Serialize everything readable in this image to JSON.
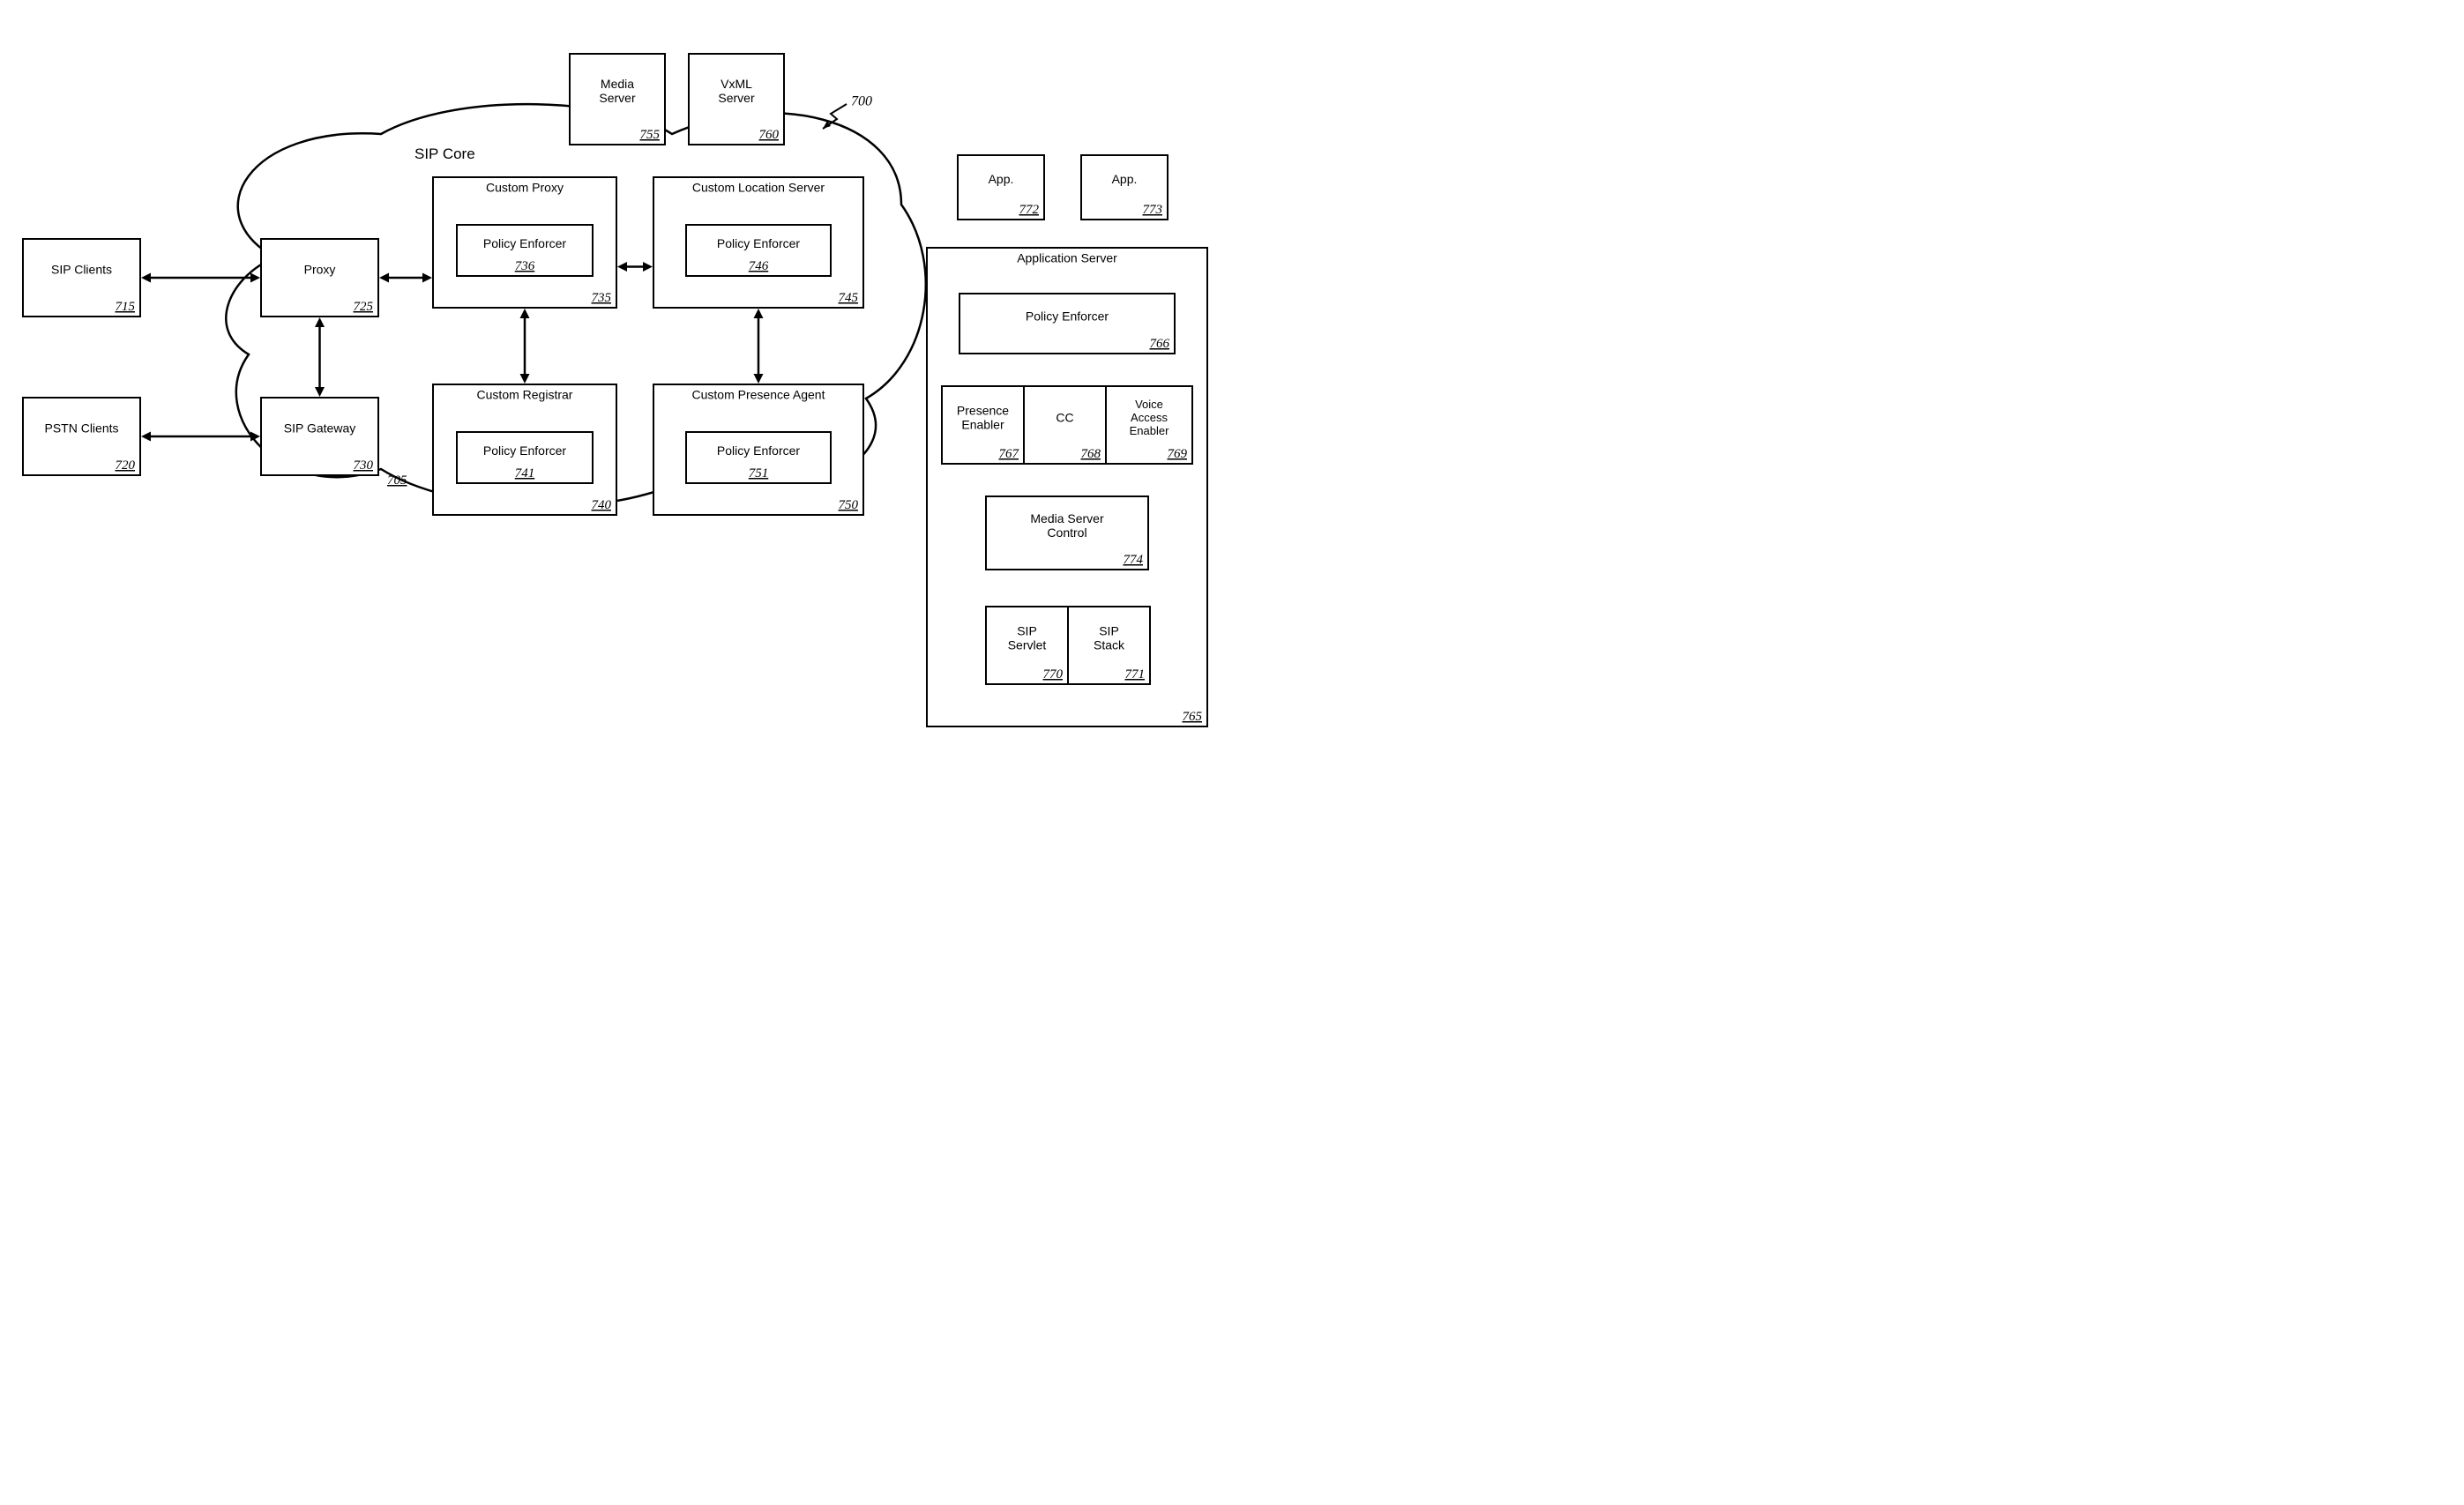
{
  "fig_ref": "700",
  "sip_core_label": "SIP Core",
  "sip_core_ref": "705",
  "sip_clients": {
    "title": "SIP Clients",
    "ref": "715"
  },
  "pstn_clients": {
    "title": "PSTN Clients",
    "ref": "720"
  },
  "proxy": {
    "title": "Proxy",
    "ref": "725"
  },
  "sip_gateway": {
    "title": "SIP Gateway",
    "ref": "730"
  },
  "custom_proxy": {
    "title": "Custom Proxy",
    "ref": "735",
    "pe_title": "Policy Enforcer",
    "pe_ref": "736"
  },
  "custom_registrar": {
    "title": "Custom Registrar",
    "ref": "740",
    "pe_title": "Policy Enforcer",
    "pe_ref": "741"
  },
  "custom_location": {
    "title": "Custom Location Server",
    "ref": "745",
    "pe_title": "Policy Enforcer",
    "pe_ref": "746"
  },
  "custom_presence": {
    "title": "Custom Presence Agent",
    "ref": "750",
    "pe_title": "Policy Enforcer",
    "pe_ref": "751"
  },
  "media_server": {
    "title": "Media\nServer",
    "ref": "755"
  },
  "vxml_server": {
    "title": "VxML\nServer",
    "ref": "760"
  },
  "app_server": {
    "title": "Application Server",
    "ref": "765"
  },
  "app_pe": {
    "title": "Policy Enforcer",
    "ref": "766"
  },
  "presence_enabler": {
    "title": "Presence\nEnabler",
    "ref": "767"
  },
  "cc": {
    "title": "CC",
    "ref": "768"
  },
  "voice_access": {
    "title": "Voice\nAccess\nEnabler",
    "ref": "769"
  },
  "sip_servlet": {
    "title": "SIP\nServlet",
    "ref": "770"
  },
  "sip_stack": {
    "title": "SIP\nStack",
    "ref": "771"
  },
  "app1": {
    "title": "App.",
    "ref": "772"
  },
  "app2": {
    "title": "App.",
    "ref": "773"
  },
  "media_server_control": {
    "title": "Media Server\nControl",
    "ref": "774"
  }
}
